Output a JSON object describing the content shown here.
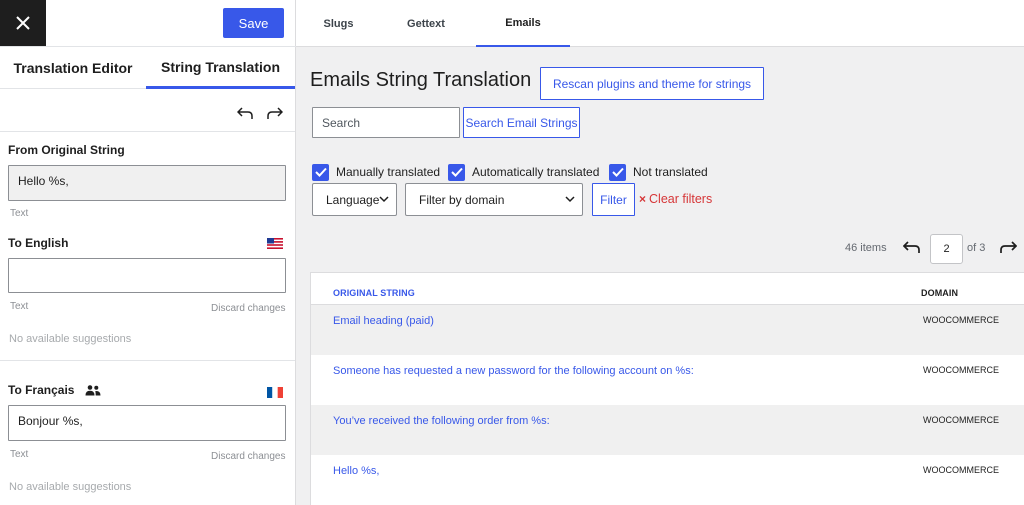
{
  "header": {
    "save_label": "Save"
  },
  "left_tabs": [
    {
      "label": "Translation Editor"
    },
    {
      "label": "String Translation",
      "active": true
    }
  ],
  "original": {
    "heading": "From Original String",
    "value": "Hello %s,",
    "type_label": "Text"
  },
  "english": {
    "heading": "To English",
    "value": "",
    "type_label": "Text",
    "discard_label": "Discard changes",
    "suggestions": "No available suggestions",
    "flag": "us-flag-icon"
  },
  "francais": {
    "heading": "To Français",
    "value": "Bonjour %s,",
    "type_label": "Text",
    "discard_label": "Discard changes",
    "suggestions": "No available suggestions",
    "flag": "fr-flag-icon"
  },
  "top_tabs": [
    {
      "label": "Slugs"
    },
    {
      "label": "Gettext"
    },
    {
      "label": "Emails",
      "active": true
    }
  ],
  "main": {
    "title": "Emails String Translation",
    "rescan_label": "Rescan plugins and theme for strings",
    "search_placeholder": "Search",
    "search_button": "Search Email Strings",
    "checkboxes": [
      {
        "label": "Manually translated",
        "checked": true
      },
      {
        "label": "Automatically translated",
        "checked": true
      },
      {
        "label": "Not translated",
        "checked": true
      }
    ],
    "language_select": "Language",
    "domain_select": "Filter by domain",
    "filter_button": "Filter",
    "clear_filters": "Clear filters",
    "clear_icon": "×"
  },
  "pagination": {
    "items": "46 items",
    "current_page": "2",
    "of_text": "of 3"
  },
  "table": {
    "col_original": "ORIGINAL STRING",
    "col_domain": "DOMAIN",
    "rows": [
      {
        "original": "Email heading (paid)",
        "domain": "WOOCOMMERCE"
      },
      {
        "original": "Someone has requested a new password for the following account on %s:",
        "domain": "WOOCOMMERCE"
      },
      {
        "original": "You’ve received the following order from %s:",
        "domain": "WOOCOMMERCE"
      },
      {
        "original": "Hello %s,",
        "domain": "WOOCOMMERCE"
      }
    ]
  },
  "colors": {
    "accent": "#3858e9",
    "danger": "#d63638",
    "dark": "#1e1e1e"
  }
}
